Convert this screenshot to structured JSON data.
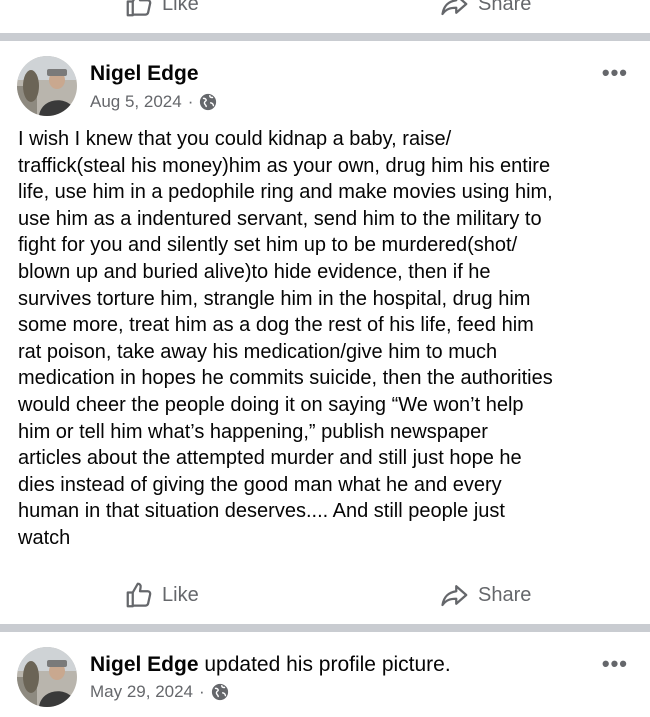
{
  "top_actions": {
    "like_label": "Like",
    "share_label": "Share"
  },
  "post1": {
    "author": "Nigel Edge",
    "date": "Aug 5, 2024",
    "separator": "·",
    "privacy_icon": "globe-icon",
    "more_label": "•••",
    "text": "I wish I knew that you could kidnap a baby, raise/\ntraffick(steal his money)him as your own, drug him his entire\nlife, use him in a pedophile ring and make movies using him,\nuse him as a indentured servant, send him to the military to\nfight for you and silently set him up to be murdered(shot/\nblown up and buried alive)to hide evidence, then if he\nsurvives torture him, strangle him in the hospital, drug him\nsome more, treat him as a dog the rest of his life, feed him\nrat poison, take away his medication/give him to much\nmedication in hopes he commits suicide, then the authorities\nwould cheer the people doing it on saying “We won’t help\nhim or tell him what’s happening,” publish newspaper\narticles about the attempted murder and still just hope he\ndies instead of giving the good man what he and every\nhuman in that situation deserves.... And still people just\nwatch"
  },
  "post1_actions": {
    "like_label": "Like",
    "share_label": "Share"
  },
  "post2": {
    "author": "Nigel Edge",
    "action_text": " updated his profile picture.",
    "date": "May 29, 2024",
    "separator": "·",
    "privacy_icon": "globe-icon",
    "more_label": "•••"
  },
  "colors": {
    "muted": "#65676b",
    "divider": "#c9ccd1",
    "text": "#050505"
  }
}
